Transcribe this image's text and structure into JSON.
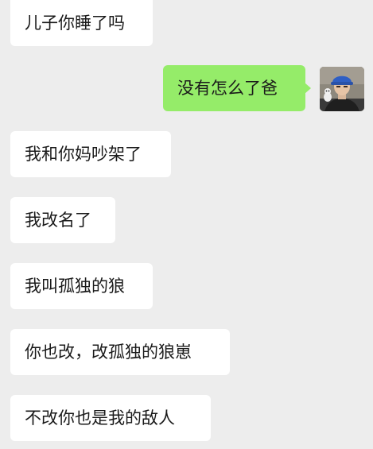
{
  "chat": {
    "messages": [
      {
        "side": "incoming",
        "text": "儿子你睡了吗"
      },
      {
        "side": "outgoing",
        "text": "没有怎么了爸"
      },
      {
        "side": "incoming",
        "text": "我和你妈吵架了"
      },
      {
        "side": "incoming",
        "text": "我改名了"
      },
      {
        "side": "incoming",
        "text": "我叫孤独的狼"
      },
      {
        "side": "incoming",
        "text": "你也改，改孤独的狼崽"
      },
      {
        "side": "incoming",
        "text": "不改你也是我的敌人"
      }
    ]
  },
  "colors": {
    "background": "#ededed",
    "incoming_bubble": "#ffffff",
    "outgoing_bubble": "#95ec69",
    "avatar_cap": "#2f5fc4"
  }
}
